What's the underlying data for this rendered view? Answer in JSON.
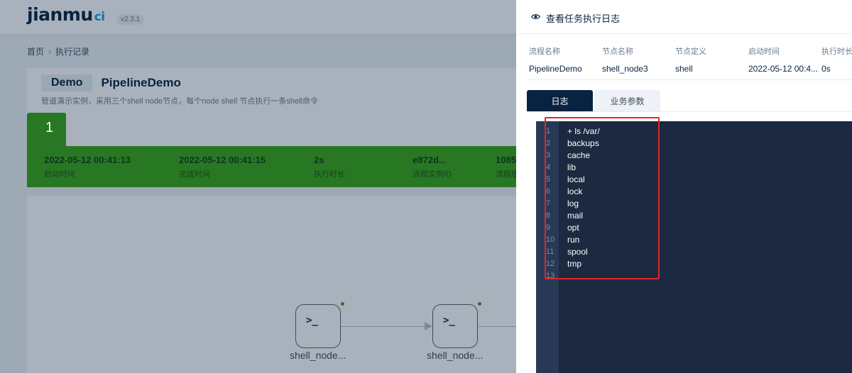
{
  "app": {
    "logo_main": "jianmu",
    "logo_suffix": "ci",
    "version": "v2.3.1"
  },
  "breadcrumb": {
    "home": "首页",
    "current": "执行记录"
  },
  "pipeline": {
    "project": "Demo",
    "name": "PipelineDemo",
    "description": "管道演示实例，采用三个shell node节点，每个node shell 节点执行一条shell命令",
    "tab_number": "1",
    "stats": [
      {
        "value": "2022-05-12 00:41:13",
        "label": "启动时间"
      },
      {
        "value": "2022-05-12 00:41:15",
        "label": "完成时间"
      },
      {
        "value": "2s",
        "label": "执行时长"
      },
      {
        "value": "e872d...",
        "label": "流程实例ID"
      },
      {
        "value": "1085",
        "label": "流程版"
      }
    ]
  },
  "graph": {
    "nodes": [
      {
        "icon": "terminal-icon",
        "label": "shell_node..."
      },
      {
        "icon": "terminal-icon",
        "label": "shell_node..."
      }
    ]
  },
  "drawer": {
    "title": "查看任务执行日志",
    "info": [
      {
        "key": "流程名称",
        "value": "PipelineDemo"
      },
      {
        "key": "节点名称",
        "value": "shell_node3"
      },
      {
        "key": "节点定义",
        "value": "shell"
      },
      {
        "key": "启动时间",
        "value": "2022-05-12 00:4..."
      },
      {
        "key": "执行时长",
        "value": "0s"
      }
    ],
    "tabs": [
      {
        "label": "日志",
        "active": true
      },
      {
        "label": "业务参数",
        "active": false
      }
    ],
    "log_lines": [
      {
        "n": "1",
        "text": "+ ls /var/"
      },
      {
        "n": "2",
        "text": "backups"
      },
      {
        "n": "3",
        "text": "cache"
      },
      {
        "n": "4",
        "text": "lib"
      },
      {
        "n": "5",
        "text": "local"
      },
      {
        "n": "6",
        "text": "lock"
      },
      {
        "n": "7",
        "text": "log"
      },
      {
        "n": "8",
        "text": "mail"
      },
      {
        "n": "9",
        "text": "opt"
      },
      {
        "n": "10",
        "text": "run"
      },
      {
        "n": "11",
        "text": "spool"
      },
      {
        "n": "12",
        "text": "tmp"
      },
      {
        "n": "13",
        "text": ""
      }
    ]
  },
  "colors": {
    "success": "#3aa615",
    "navy": "#082340",
    "highlight": "#e0262b",
    "log_bg": "#1c2940"
  }
}
